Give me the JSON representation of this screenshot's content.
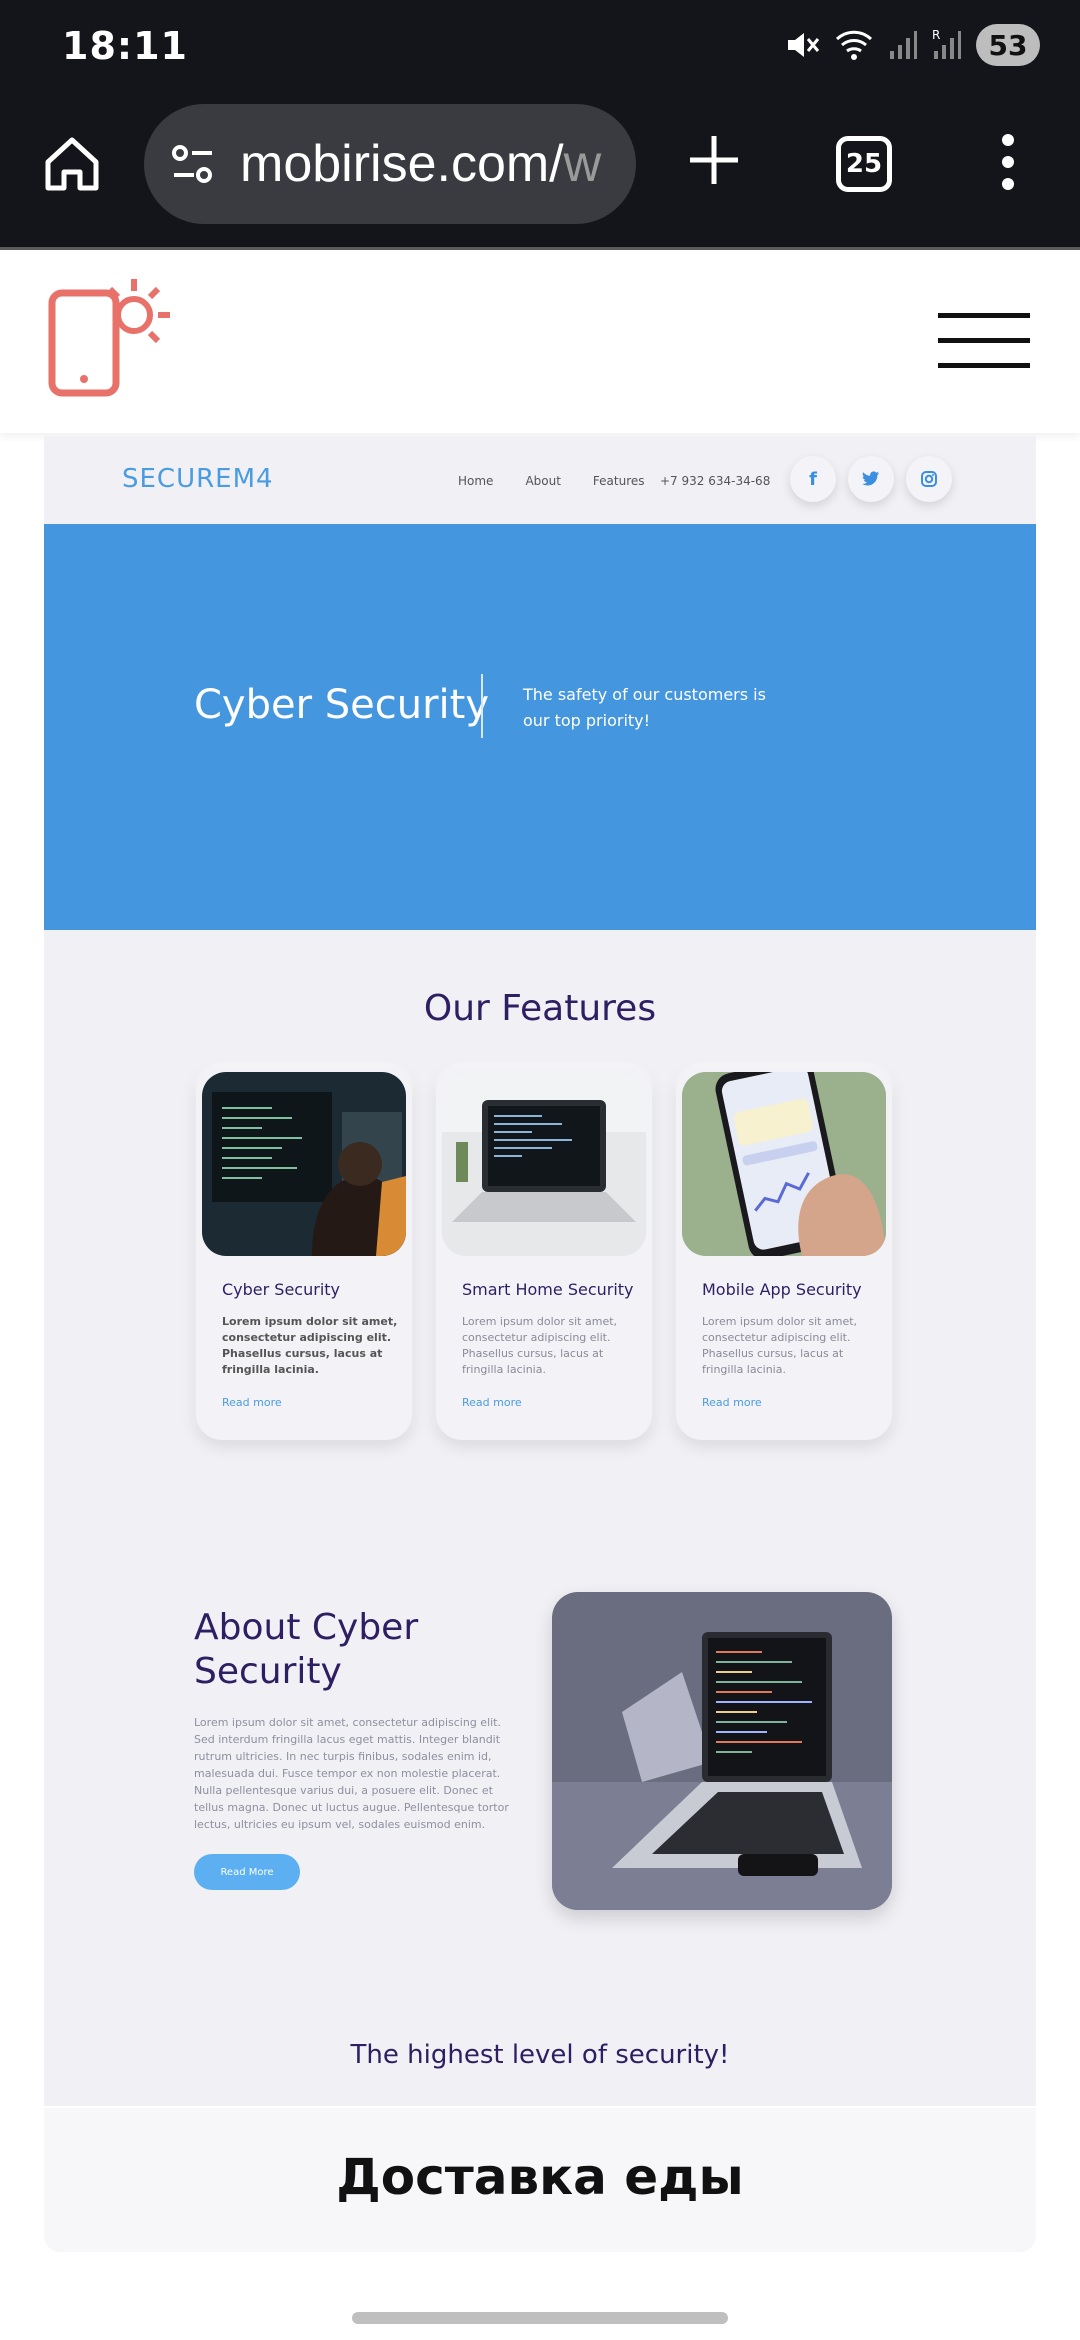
{
  "status_bar": {
    "time": "18:11",
    "battery": "53"
  },
  "browser": {
    "url_main": "mobirise.com/",
    "url_faded": "w",
    "tab_count": "25"
  },
  "preview": {
    "brand": "SECUREM4",
    "nav": [
      "Home",
      "About",
      "Features"
    ],
    "phone": "+7 932 634-34-68",
    "hero": {
      "title": "Cyber Security",
      "text": "The safety of our customers is our top priority!"
    },
    "features_title": "Our Features",
    "cards": [
      {
        "title": "Cyber Security",
        "text": "Lorem ipsum dolor sit amet, consectetur adipiscing elit. Phasellus cursus, lacus at fringilla lacinia.",
        "link": "Read more"
      },
      {
        "title": "Smart Home Security",
        "text": "Lorem ipsum dolor sit amet, consectetur adipiscing elit. Phasellus cursus, lacus at fringilla lacinia.",
        "link": "Read more"
      },
      {
        "title": "Mobile App Security",
        "text": "Lorem ipsum dolor sit amet, consectetur adipiscing elit. Phasellus cursus, lacus at fringilla lacinia.",
        "link": "Read more"
      }
    ],
    "about": {
      "title": "About Cyber Security",
      "text": "Lorem ipsum dolor sit amet, consectetur adipiscing elit. Sed interdum fringilla lacus eget mattis. Integer blandit rutrum ultricies. In nec turpis finibus, sodales enim id, malesuada dui. Fusce tempor ex non molestie placerat. Nulla pellentesque varius dui, a posuere elit. Donec et tellus magna. Donec ut luctus augue. Pellentesque tortor lectus, ultricies eu ipsum vel, sodales euismod enim.",
      "button": "Read More"
    },
    "level_title": "The highest level of security!"
  },
  "bottom_banner": {
    "text": "Доставка еды"
  },
  "colors": {
    "hero_blue": "#4496df",
    "heading_purple": "#2e1f63",
    "logo_coral": "#e8716a"
  }
}
